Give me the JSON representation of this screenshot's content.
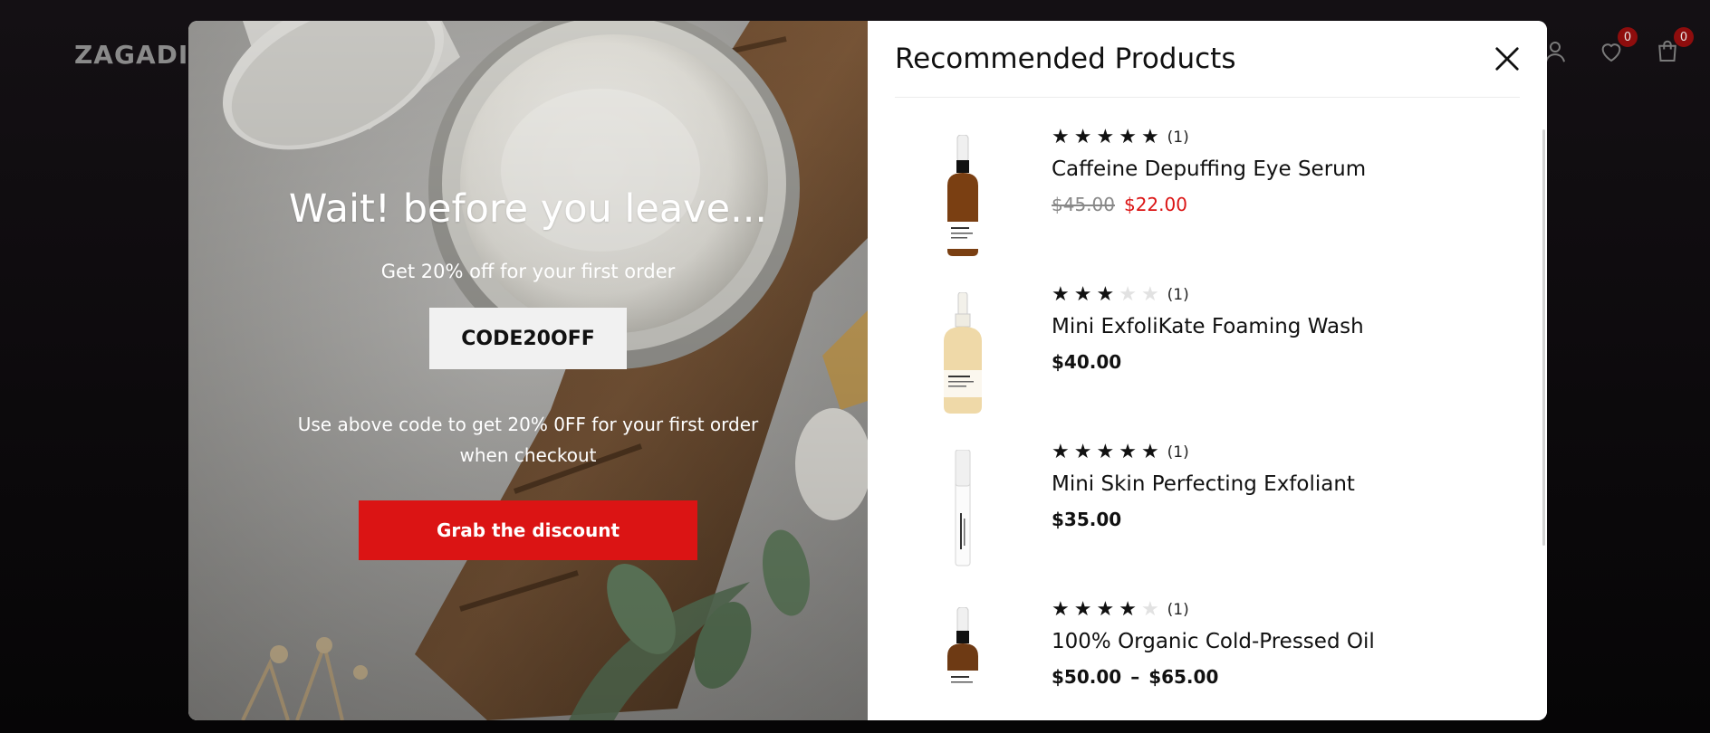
{
  "site": {
    "logo": "ZAGADIX",
    "wishlist_count": "0",
    "cart_count": "0",
    "icons": [
      "user-icon",
      "heart-icon",
      "bag-icon"
    ]
  },
  "promo": {
    "title": "Wait! before you leave...",
    "subtitle": "Get 20% off for your first order",
    "code": "CODE20OFF",
    "note": "Use above code to get 20% 0FF for your first order when checkout",
    "button_label": "Grab the discount",
    "button_color": "#db1414"
  },
  "recommended": {
    "title": "Recommended Products",
    "products": [
      {
        "name": "Caffeine Depuffing Eye Serum",
        "rating": 5,
        "review_count": "(1)",
        "price_old": "$45.00",
        "price": "$22.00",
        "on_sale": true
      },
      {
        "name": "Mini ExfoliKate Foaming Wash",
        "rating": 3,
        "review_count": "(1)",
        "price": "$40.00",
        "on_sale": false
      },
      {
        "name": "Mini Skin Perfecting Exfoliant",
        "rating": 5,
        "review_count": "(1)",
        "price": "$35.00",
        "on_sale": false
      },
      {
        "name": "100% Organic Cold-Pressed Oil",
        "rating": 4,
        "review_count": "(1)",
        "price_min": "$50.00",
        "price_sep": "–",
        "price_max": "$65.00",
        "on_sale": false
      }
    ]
  }
}
